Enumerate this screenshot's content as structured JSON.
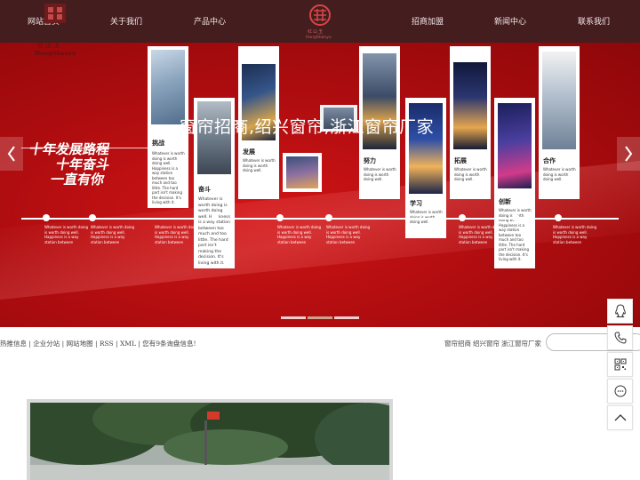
{
  "brand": {
    "name_cn": "红山玉",
    "name_en": "HongShanyu"
  },
  "nav": {
    "items": [
      "网站首页",
      "关于我们",
      "产品中心",
      "招商加盟",
      "新闻中心",
      "联系我们"
    ]
  },
  "banner": {
    "title": "窗帘招商,绍兴窗帘,浙江窗帘厂家",
    "slogan": [
      "十年发展路程",
      "十年奋斗",
      "一直有你"
    ],
    "card_text_short": "Whatever is worth doing is worth doing well.",
    "card_text_long": "Whatever is worth doing is worth doing well. Happiness is a way station between too much and too little. The hard part isn't making the decision. It's living with it.",
    "stations": [
      "挑战",
      "奋斗",
      "发展",
      "努力",
      "学习",
      "拓展",
      "创新",
      "合作"
    ],
    "bottom_text": "Whatever is worth doing is worth doing well. Happiness is a way station between",
    "pager_count": 3,
    "active_pager": 1,
    "colors": {
      "banner_red": "#b10d10",
      "header_bg": "#340a0c"
    }
  },
  "links": {
    "hot_links": "热推信息 | 企业分站 | 网站地图 | RSS | XML | 您有9条询盘信息!",
    "keywords": [
      "窗帘招商",
      "绍兴窗帘",
      "浙江窗帘厂家"
    ]
  },
  "search": {
    "placeholder": ""
  },
  "sidebar": {
    "icons": [
      "qq-icon",
      "phone-icon",
      "qrcode-icon",
      "message-icon",
      "back-to-top-icon"
    ]
  }
}
